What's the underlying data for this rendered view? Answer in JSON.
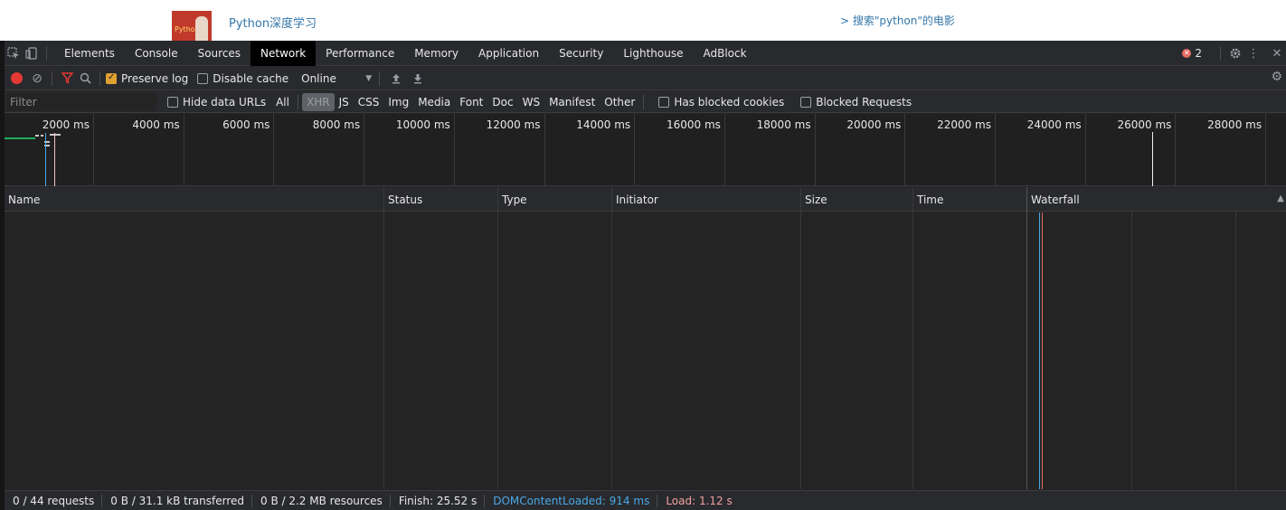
{
  "webpage": {
    "book_cover_text": "Python",
    "book_title": "Python深度学习",
    "search_link": "> 搜索\"python\"的电影"
  },
  "tabs": [
    {
      "label": "Elements",
      "active": false
    },
    {
      "label": "Console",
      "active": false
    },
    {
      "label": "Sources",
      "active": false
    },
    {
      "label": "Network",
      "active": true
    },
    {
      "label": "Performance",
      "active": false
    },
    {
      "label": "Memory",
      "active": false
    },
    {
      "label": "Application",
      "active": false
    },
    {
      "label": "Security",
      "active": false
    },
    {
      "label": "Lighthouse",
      "active": false
    },
    {
      "label": "AdBlock",
      "active": false
    }
  ],
  "tabbar_right": {
    "error_count": "2"
  },
  "toolbar": {
    "preserve_log": "Preserve log",
    "preserve_log_checked": true,
    "disable_cache": "Disable cache",
    "disable_cache_checked": false,
    "throttling": "Online"
  },
  "filterbar": {
    "placeholder": "Filter",
    "hide_data_urls": "Hide data URLs",
    "types": [
      {
        "label": "All",
        "active": false
      },
      {
        "label": "XHR",
        "active": true
      },
      {
        "label": "JS",
        "active": false
      },
      {
        "label": "CSS",
        "active": false
      },
      {
        "label": "Img",
        "active": false
      },
      {
        "label": "Media",
        "active": false
      },
      {
        "label": "Font",
        "active": false
      },
      {
        "label": "Doc",
        "active": false
      },
      {
        "label": "WS",
        "active": false
      },
      {
        "label": "Manifest",
        "active": false
      },
      {
        "label": "Other",
        "active": false
      }
    ],
    "has_blocked_cookies": "Has blocked cookies",
    "blocked_requests": "Blocked Requests"
  },
  "overview": {
    "ticks": [
      "2000 ms",
      "4000 ms",
      "6000 ms",
      "8000 ms",
      "10000 ms",
      "12000 ms",
      "14000 ms",
      "16000 ms",
      "18000 ms",
      "20000 ms",
      "22000 ms",
      "24000 ms",
      "26000 ms",
      "28000 ms"
    ]
  },
  "columns": {
    "name": "Name",
    "status": "Status",
    "type": "Type",
    "initiator": "Initiator",
    "size": "Size",
    "time": "Time",
    "waterfall": "Waterfall"
  },
  "status": {
    "requests": "0 / 44 requests",
    "transferred": "0 B / 31.1 kB transferred",
    "resources": "0 B / 2.2 MB resources",
    "finish": "Finish: 25.52 s",
    "dom_content_loaded": "DOMContentLoaded: 914 ms",
    "load": "Load: 1.12 s"
  },
  "colors": {
    "accent_red": "#e53935",
    "preserve_checked": "#e0a030",
    "dcl_blue": "#4aa8e8",
    "load_red": "#f3a0a0"
  }
}
